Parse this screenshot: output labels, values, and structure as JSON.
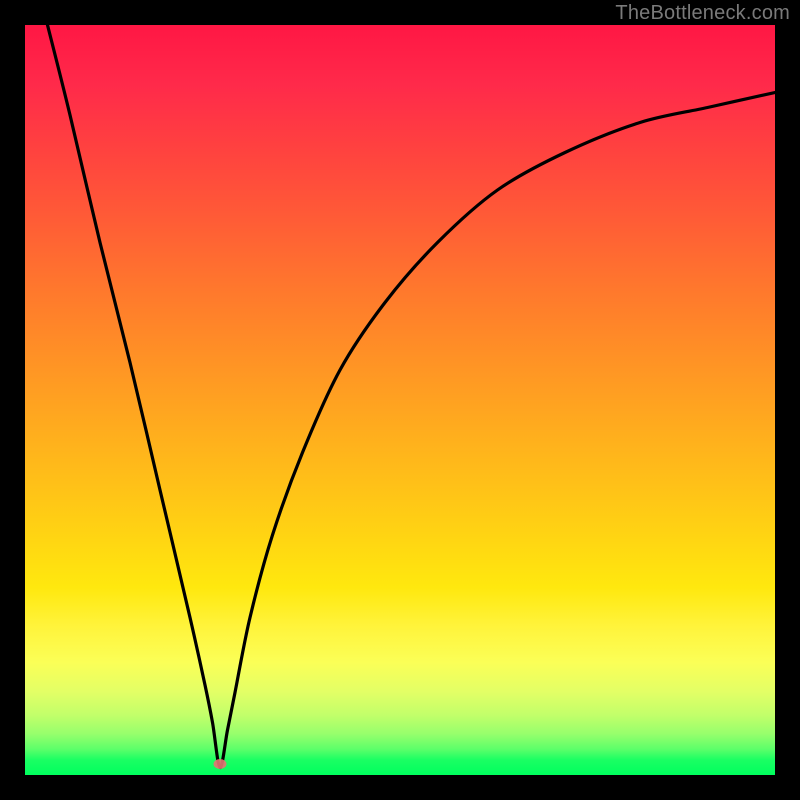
{
  "watermark": "TheBottleneck.com",
  "colors": {
    "frame": "#000000",
    "marker": "#e57373",
    "curve": "#000000",
    "gradient_top": "#ff1744",
    "gradient_bottom": "#00ff5e"
  },
  "chart_data": {
    "type": "line",
    "title": "",
    "xlabel": "",
    "ylabel": "",
    "xlim": [
      0,
      100
    ],
    "ylim": [
      0,
      100
    ],
    "grid": false,
    "legend": false,
    "axes_visible": false,
    "annotations": [
      "TheBottleneck.com"
    ],
    "min_point": {
      "x": 26,
      "y": 1
    },
    "marker": {
      "x": 26,
      "y": 1.5,
      "color": "#e57373"
    },
    "series": [
      {
        "name": "bottleneck-curve",
        "x": [
          3,
          6,
          10,
          14,
          18,
          22,
          24,
          25,
          26,
          27,
          28,
          30,
          33,
          37,
          42,
          48,
          55,
          63,
          72,
          82,
          91,
          100
        ],
        "values": [
          100,
          88,
          71,
          55,
          38,
          21,
          12,
          7,
          1,
          6,
          11,
          21,
          32,
          43,
          54,
          63,
          71,
          78,
          83,
          87,
          89,
          91
        ]
      }
    ]
  }
}
